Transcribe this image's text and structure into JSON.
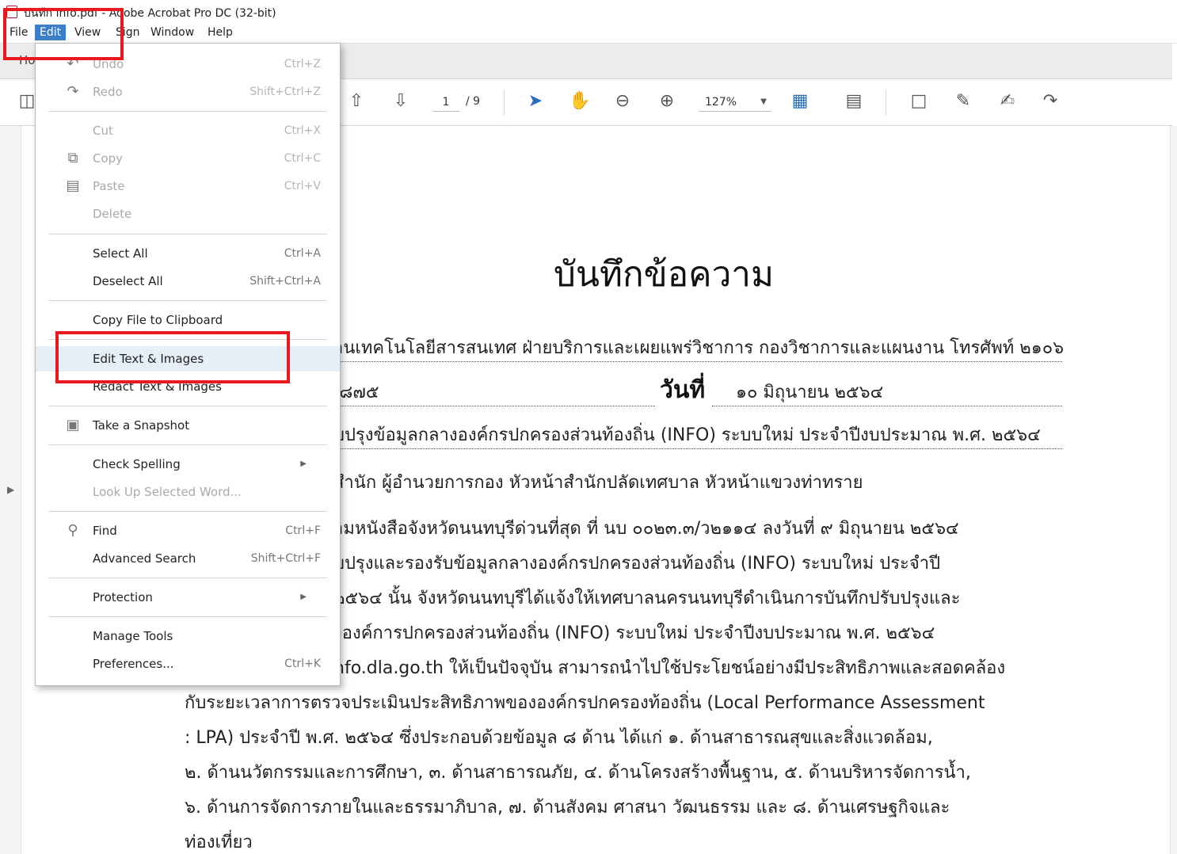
{
  "window": {
    "title": "บันทึก info.pdf - Adobe Acrobat Pro DC (32-bit)"
  },
  "menubar": {
    "items": [
      "File",
      "Edit",
      "View",
      "Sign",
      "Window",
      "Help"
    ],
    "active": "Edit"
  },
  "tabs": {
    "home": "Ho"
  },
  "toolbar": {
    "page_current": "1",
    "page_total": "/ 9",
    "zoom": "127%"
  },
  "icons": [
    "save-icon",
    "page-up-icon",
    "page-down-icon",
    "select-cursor-icon",
    "hand-icon",
    "zoom-out-icon",
    "zoom-in-icon",
    "fit-page-icon",
    "scroll-mode-icon",
    "comment-icon",
    "highlight-icon",
    "sign-icon",
    "share-icon",
    "caret-icon"
  ],
  "edit_menu": {
    "undo": {
      "label": "Undo",
      "shortcut": "Ctrl+Z"
    },
    "redo": {
      "label": "Redo",
      "shortcut": "Shift+Ctrl+Z"
    },
    "cut": {
      "label": "Cut",
      "shortcut": "Ctrl+X"
    },
    "copy": {
      "label": "Copy",
      "shortcut": "Ctrl+C"
    },
    "paste": {
      "label": "Paste",
      "shortcut": "Ctrl+V"
    },
    "delete": {
      "label": "Delete"
    },
    "select_all": {
      "label": "Select All",
      "shortcut": "Ctrl+A"
    },
    "deselect_all": {
      "label": "Deselect All",
      "shortcut": "Shift+Ctrl+A"
    },
    "copy_file": {
      "label": "Copy File to Clipboard"
    },
    "edit_text": {
      "label": "Edit Text & Images"
    },
    "redact": {
      "label": "Redact Text & Images"
    },
    "snapshot": {
      "label": "Take a Snapshot"
    },
    "check_spelling": {
      "label": "Check Spelling"
    },
    "look_up": {
      "label": "Look Up Selected Word..."
    },
    "find": {
      "label": "Find",
      "shortcut": "Ctrl+F"
    },
    "advanced_search": {
      "label": "Advanced Search",
      "shortcut": "Shift+Ctrl+F"
    },
    "protection": {
      "label": "Protection"
    },
    "manage_tools": {
      "label": "Manage Tools"
    },
    "preferences": {
      "label": "Preferences...",
      "shortcut": "Ctrl+K"
    }
  },
  "document": {
    "title": "บันทึกข้อความ",
    "line1": "านเทคโนโลยีสารสนเทศ ฝ่ายบริการและเผยแพร่วิชาการ กองวิชาการและแผนงาน โทรศัพท์ ๒๑๐๖",
    "line2_left": "/๘๗๕",
    "date_label": "วันที่",
    "date_value": "๑๐ มิถุนายน ๒๕๖๔",
    "line3": "ับปรุงข้อมูลกลางองค์กรปกครองส่วนท้องถิ่น (INFO) ระบบใหม่ ประจำปีงบประมาณ พ.ศ. ๒๕๖๔",
    "line4": "สำนัก ผู้อำนวยการกอง หัวหน้าสำนักปลัดเทศบาล หัวหน้าแขวงท่าทราย",
    "p1": "ามหนังสือจังหวัดนนทบุรีด่วนที่สุด ที่ นบ ๐๐๒๓.๓/ว๒๑๑๔ ลงวันที่ ๙ มิถุนายน ๒๕๖๔",
    "p2": "ับปรุงและรองรับข้อมูลกลางองค์กรปกครองส่วนท้องถิ่น (INFO) ระบบใหม่ ประจำปี",
    "p3": "๒๕๖๔ นั้น จังหวัดนนทบุรีได้แจ้งให้เทศบาลนครนนทบุรีดำเนินการบันทึกปรับปรุงและ",
    "p4": "งองค์การปกครองส่วนท้องถิ่น (INFO) ระบบใหม่ ประจำปีงบประมาณ พ.ศ. ๒๕๖๔",
    "p5": "nfo.dla.go.th ให้เป็นปัจจุบัน สามารถนำไปใช้ประโยชน์อย่างมีประสิทธิภาพและสอดคล้อง",
    "p6": "กับระยะเวลาการตรวจประเมินประสิทธิภาพขององค์กรปกครองท้องถิ่น (Local Performance Assessment",
    "p7": ": LPA) ประจำปี พ.ศ. ๒๕๖๔ ซึ่งประกอบด้วยข้อมูล ๘ ด้าน ได้แก่ ๑. ด้านสาธารณสุขและสิ่งแวดล้อม,",
    "p8": "๒. ด้านนวัตกรรมและการศึกษา, ๓. ด้านสาธารณภัย, ๔. ด้านโครงสร้างพื้นฐาน, ๕. ด้านบริหารจัดการน้ำ,",
    "p9": "๖. ด้านการจัดการภายในและธรรมาภิบาล, ๗. ด้านสังคม ศาสนา วัฒนธรรม และ ๘. ด้านเศรษฐกิจและ",
    "p10": "ท่องเที่ยว"
  },
  "colors": {
    "menu_active": "#3d7ec8",
    "highlight_box": "#e8191f",
    "hover": "#e6eef8"
  }
}
